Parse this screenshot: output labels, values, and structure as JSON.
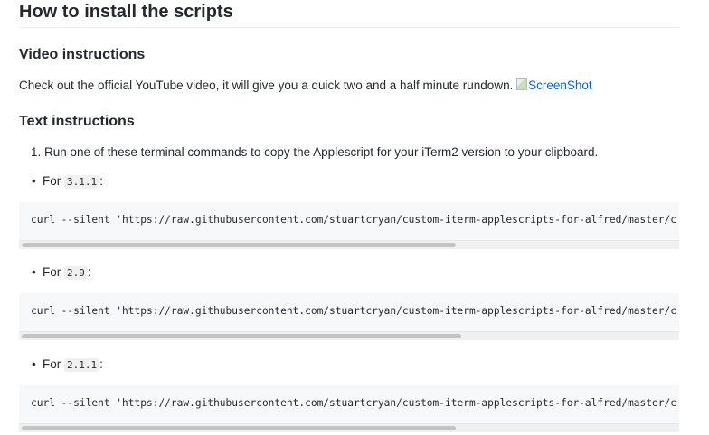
{
  "heading": "How to install the scripts",
  "video": {
    "heading": "Video instructions",
    "text": "Check out the official YouTube video, it will give you a quick two and a half minute rundown.",
    "image_alt": "ScreenShot"
  },
  "text_instructions": {
    "heading": "Text instructions",
    "step": "1. Run one of these terminal commands to copy the Applescript for your iTerm2 version to your clipboard."
  },
  "versions": [
    {
      "prefix": "For",
      "version": "3.1.1",
      "suffix": ":",
      "command": "curl --silent 'https://raw.githubusercontent.com/stuartcryan/custom-iterm-applescripts-for-alfred/master/c"
    },
    {
      "prefix": "For",
      "version": "2.9",
      "suffix": ":",
      "command": "curl --silent 'https://raw.githubusercontent.com/stuartcryan/custom-iterm-applescripts-for-alfred/master/c"
    },
    {
      "prefix": "For",
      "version": "2.1.1",
      "suffix": ":",
      "command": "curl --silent 'https://raw.githubusercontent.com/stuartcryan/custom-iterm-applescripts-for-alfred/master/c"
    }
  ]
}
